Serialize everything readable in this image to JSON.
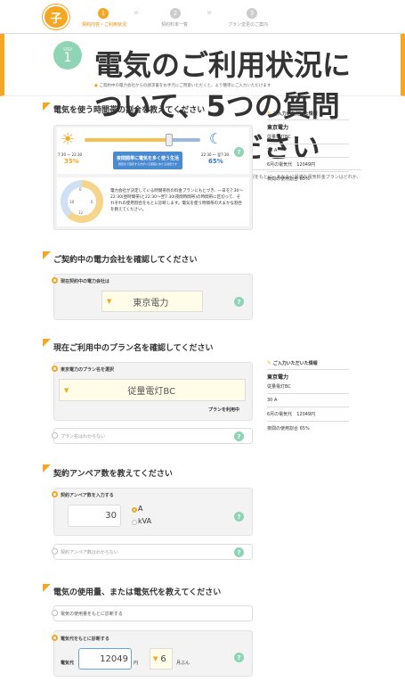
{
  "header": {
    "logo_text": "子",
    "steps": [
      {
        "num": "1",
        "label": "契約内容・ご利用状況"
      },
      {
        "num": "2",
        "label": "契約料率一覧"
      },
      {
        "num": "3",
        "label": "プラン変更のご案内"
      }
    ]
  },
  "intro": {
    "step_small": "STEP",
    "step_num": "1",
    "title": "電気のご利用状況について、5つの質問に答えてください",
    "desc": "エネチェンジプラン診断は、お答えいただいた契約中のプランや電気の使用状況をもとに、あなたに最適な電気料金プランはどれか、いくらくらいの節約が期待できるのかを診断することができます。",
    "note": "ご契約中の電力会社からの請求書をお手元にご用意いただくと、より簡単にご入力いただけます"
  },
  "q1": {
    "title": "電気を使う時間帯の割合を教えてください",
    "day_range": "7:30 ～ 22:30",
    "day_pct": "35%",
    "night_range": "22:30 ～ 翌7:30",
    "night_pct": "65%",
    "slider_label": "夜間開帯に電気を多く使う生活",
    "slider_sub": "調査まで固定する方がいる家庭にあたる割合です",
    "clock_nums": [
      "6",
      "18",
      "12",
      "0"
    ],
    "explain": "電力会社が決定している時間帯別の料金プランにもとづき、一日を7:30～22:30(昼時間帯)と22:30～翌7:30(夜間時間帯)の時間帯に区切って、それぞれの使用割合をもとに診断します。電気を使う時間帯の大まかな割合を教えてください。"
  },
  "q2": {
    "title": "ご契約中の電力会社を確認してください",
    "label": "現在契約中の電力会社は",
    "value": "東京電力"
  },
  "q3": {
    "title": "現在ご利用中のプラン名を確認してください",
    "label": "東京電力のプラン名を選択",
    "value": "従量電灯BC",
    "note": "プランを利用中",
    "unknown": "プラン名はわからない"
  },
  "q4": {
    "title": "契約アンペア数を教えてください",
    "label": "契約アンペア数を入力する",
    "value": "30",
    "unit_a": "A",
    "unit_kva": "kVA",
    "unknown": "契約アンペア数はわからない"
  },
  "q5": {
    "title": "電気の使用量、または電気代を教えてください",
    "opt1": "電気の使用量をもとに診断する",
    "opt2": "電気代をもとに診断する",
    "fee_label": "電気代",
    "fee_value": "12049",
    "yen": "円",
    "month": "6",
    "month_unit": "月ぶん"
  },
  "sidebar": {
    "heading": "ご入力いただいた情報",
    "company": "東京電力",
    "plan": "従量電灯BC",
    "amp": "30 A",
    "fee_line_label": "6月の電気代",
    "fee_line_value": "12049円",
    "night_line": "夜間の使用割合 65%"
  },
  "colors": {
    "accent": "#f5a623",
    "mint": "#8fd4b4",
    "blue": "#3a78c7"
  }
}
